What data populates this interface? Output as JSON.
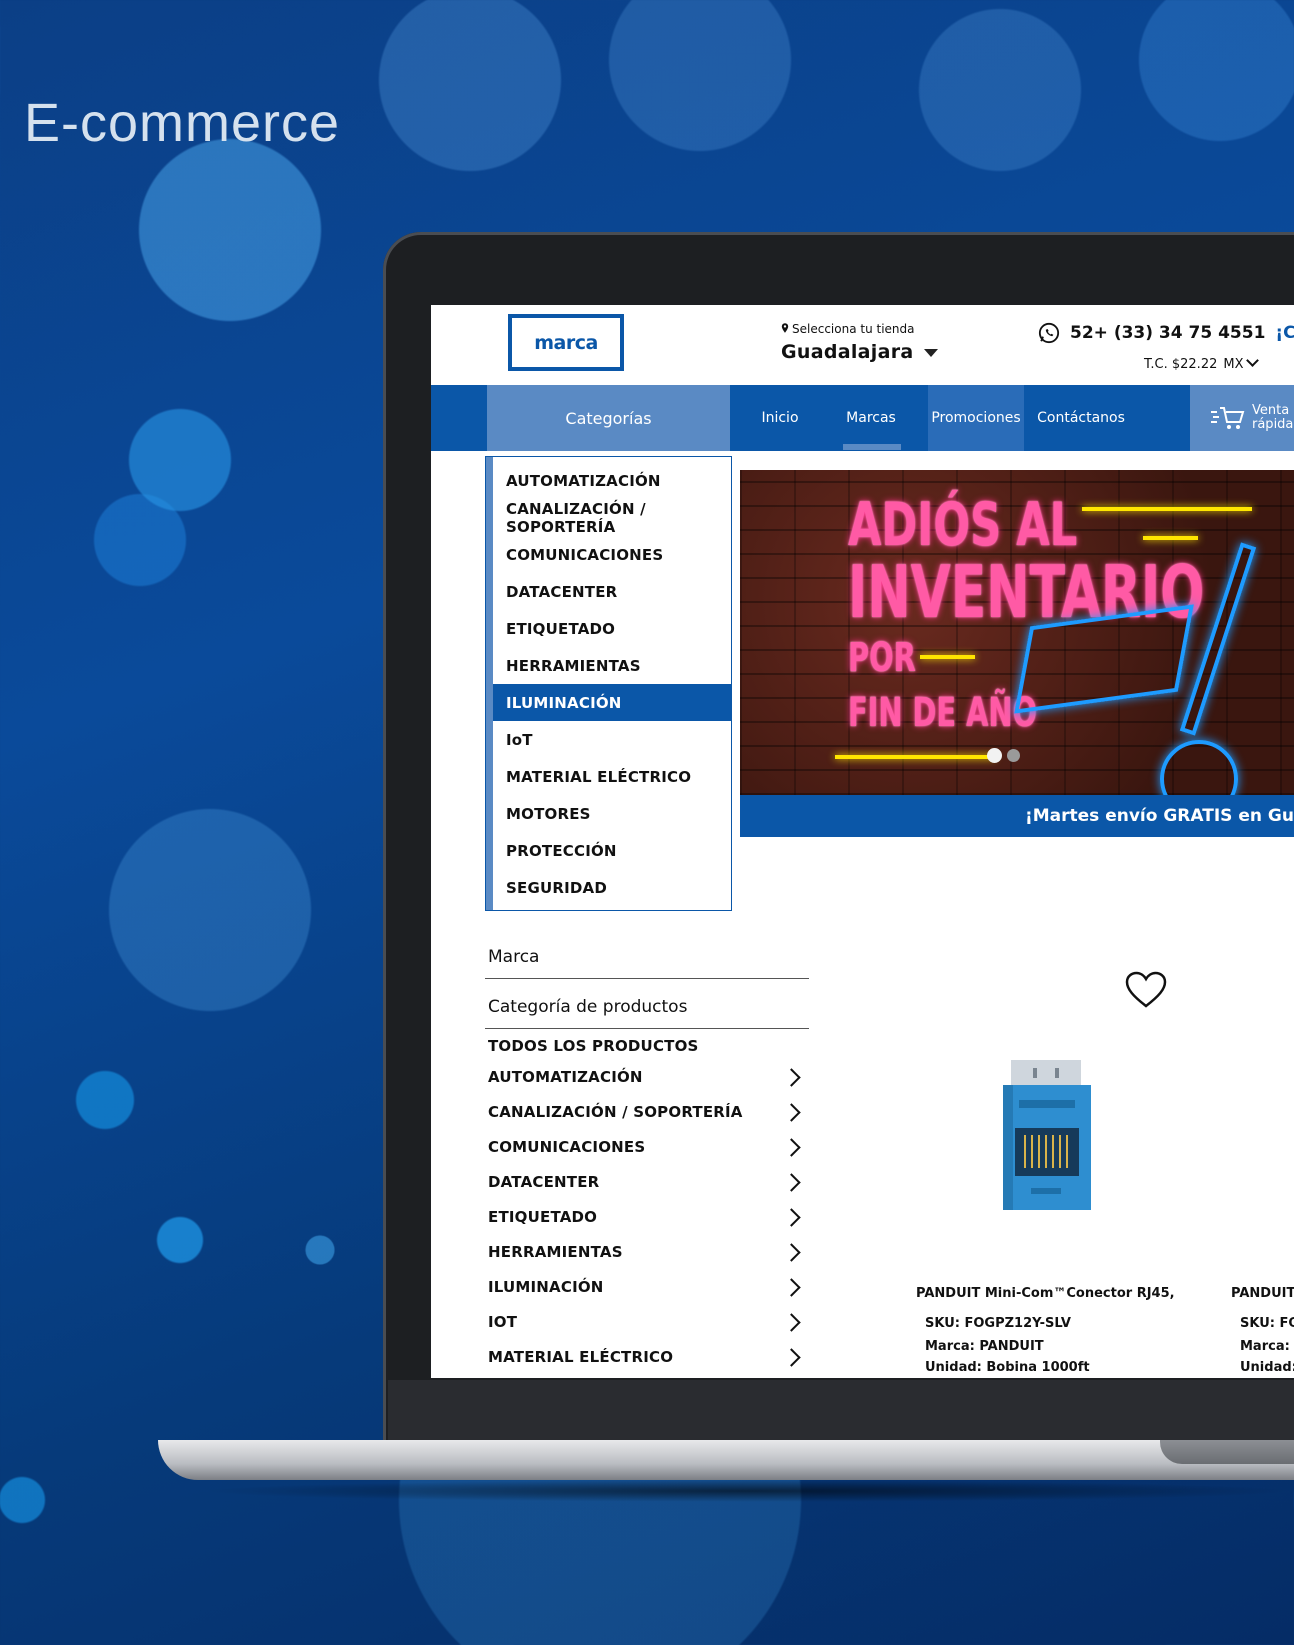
{
  "hero": {
    "title": "E-commerce"
  },
  "header": {
    "logo_text": "marca",
    "store_label": "Selecciona tu tienda",
    "store_value": "Guadalajara",
    "phone": "52+ (33) 34 75 4551",
    "contact_link": "¡Cont",
    "exchange_rate": "T.C. $22.22",
    "currency": "MX"
  },
  "nav": {
    "categories": "Categorías",
    "items": [
      "Inicio",
      "Marcas",
      "Promociones",
      "Contáctanos"
    ],
    "quick_sale_line1": "Venta",
    "quick_sale_line2": "rápida"
  },
  "dropdown": {
    "items": [
      "AUTOMATIZACIÓN",
      "CANALIZACIÓN / SOPORTERÍA",
      "COMUNICACIONES",
      "DATACENTER",
      "ETIQUETADO",
      "HERRAMIENTAS",
      "ILUMINACIÓN",
      "IoT",
      "MATERIAL ELÉCTRICO",
      "MOTORES",
      "PROTECCIÓN",
      "SEGURIDAD"
    ],
    "active": "ILUMINACIÓN"
  },
  "banner": {
    "line1": "ADIÓS AL",
    "line2": "INVENTARIO",
    "line3": "POR",
    "line4": "FIN DE AÑO",
    "slides": 2,
    "active_slide": 1
  },
  "promo_strip": "¡Martes envío GRATIS en Guad",
  "filters": {
    "brand_title": "Marca",
    "category_title": "Categoría de productos",
    "all_products": "TODOS LOS PRODUCTOS",
    "categories": [
      "AUTOMATIZACIÓN",
      "CANALIZACIÓN / SOPORTERÍA",
      "COMUNICACIONES",
      "DATACENTER",
      "ETIQUETADO",
      "HERRAMIENTAS",
      "ILUMINACIÓN",
      "IOT",
      "MATERIAL ELÉCTRICO"
    ]
  },
  "products": [
    {
      "name": "PANDUIT Mini-Com™Conector RJ45,",
      "sku": "SKU: FOGPZ12Y-SLV",
      "brand": "Marca: PANDUIT",
      "unit": "Unidad: Bobina 1000ft"
    },
    {
      "name": "PANDUIT M",
      "sku": "SKU: FOC",
      "brand": "Marca: I",
      "unit": "Unidad:"
    }
  ],
  "colors": {
    "primary": "#0b57a8",
    "secondary": "#5a8ac4",
    "neon_pink": "#ff5aa5",
    "neon_yellow": "#ffe600",
    "neon_blue": "#1e9bff"
  }
}
